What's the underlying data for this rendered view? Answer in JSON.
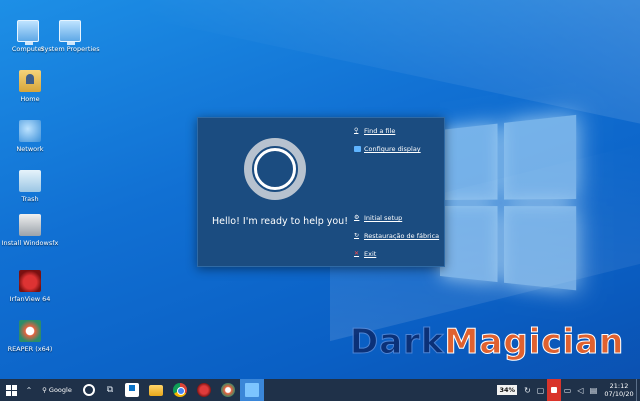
{
  "desktop": {
    "icons": [
      {
        "label": "Computer",
        "icon": "computer-icon"
      },
      {
        "label": "System Properties",
        "icon": "system-properties-icon"
      },
      {
        "label": "Home",
        "icon": "home-folder-icon"
      },
      {
        "label": "Network",
        "icon": "network-icon"
      },
      {
        "label": "Trash",
        "icon": "trash-icon"
      },
      {
        "label": "Install Windowsfx",
        "icon": "install-disk-icon"
      },
      {
        "label": "IrfanView 64",
        "icon": "irfanview-icon"
      },
      {
        "label": "REAPER (x64)",
        "icon": "reaper-icon"
      }
    ]
  },
  "assistant": {
    "greeting": "Hello! I'm ready to help you!",
    "menu": [
      {
        "label": "Find a file",
        "icon": "search-icon"
      },
      {
        "label": "Configure display",
        "icon": "display-icon"
      },
      {
        "label": "Initial setup",
        "icon": "gear-icon"
      },
      {
        "label": "Restauração de fábrica",
        "icon": "restore-icon"
      },
      {
        "label": "Exit",
        "icon": "close-icon"
      }
    ]
  },
  "watermark": {
    "part1": "Dark",
    "part2": "Magician"
  },
  "taskbar": {
    "search_label": "Google",
    "apps": [
      "store",
      "file-manager",
      "chrome",
      "irfanview",
      "reaper",
      "active-window"
    ],
    "battery": "34%",
    "clock_time": "21:12",
    "clock_date": "07/10/20"
  }
}
